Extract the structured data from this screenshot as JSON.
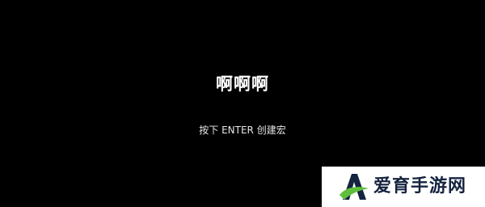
{
  "macro": {
    "name": "啊啊啊",
    "hint": "按下 ENTER 创建宏"
  },
  "watermark": {
    "text": "爱育手游网",
    "logo": "A-leaf-logo",
    "colors": {
      "background": "#ffffff",
      "text": "#14233f",
      "logo_dark": "#14233f",
      "logo_green": "#5fbf3c"
    }
  },
  "colors": {
    "background": "#000000",
    "title": "#ffffff",
    "hint": "#e6e6e6"
  }
}
